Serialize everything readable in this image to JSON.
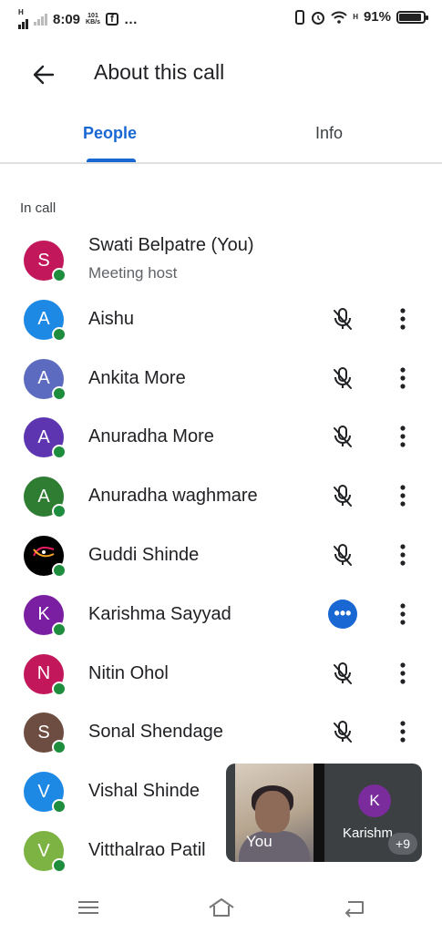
{
  "status": {
    "time": "8:09",
    "speed": "101",
    "speed_unit": "KB/s",
    "net_small_left": "H",
    "net_small_right": "H",
    "dots": "…",
    "battery": "91%",
    "battery_level": 0.91
  },
  "header": {
    "title": "About this call"
  },
  "tabs": [
    {
      "label": "People"
    },
    {
      "label": "Info"
    }
  ],
  "section": {
    "label": "In call"
  },
  "colors": {
    "accent": "#1967d2",
    "online": "#1e8e3e"
  },
  "participants": [
    {
      "initial": "S",
      "name": "Swati Belpatre (You)",
      "subtitle": "Meeting host",
      "color": "#c2185b"
    },
    {
      "initial": "A",
      "name": "Aishu",
      "color": "#1e88e5"
    },
    {
      "initial": "A",
      "name": "Ankita More",
      "color": "#5c6bc0"
    },
    {
      "initial": "A",
      "name": "Anuradha More",
      "color": "#5e35b1"
    },
    {
      "initial": "A",
      "name": "Anuradha waghmare",
      "color": "#2e7d32"
    },
    {
      "initial": "",
      "name": "Guddi Shinde",
      "color": "#000000"
    },
    {
      "initial": "K",
      "name": "Karishma Sayyad",
      "color": "#7b1fa2"
    },
    {
      "initial": "N",
      "name": "Nitin Ohol",
      "color": "#c2185b"
    },
    {
      "initial": "S",
      "name": "Sonal Shendage",
      "color": "#6d4c41"
    },
    {
      "initial": "V",
      "name": "Vishal Shinde",
      "color": "#1e88e5"
    },
    {
      "initial": "V",
      "name": "Vitthalrao Patil",
      "color": "#7cb342"
    }
  ],
  "preview": {
    "self_label": "You",
    "other_initial": "K",
    "other_label": "Karishm",
    "extra_count": "+9"
  },
  "talk_indicator": "•••"
}
